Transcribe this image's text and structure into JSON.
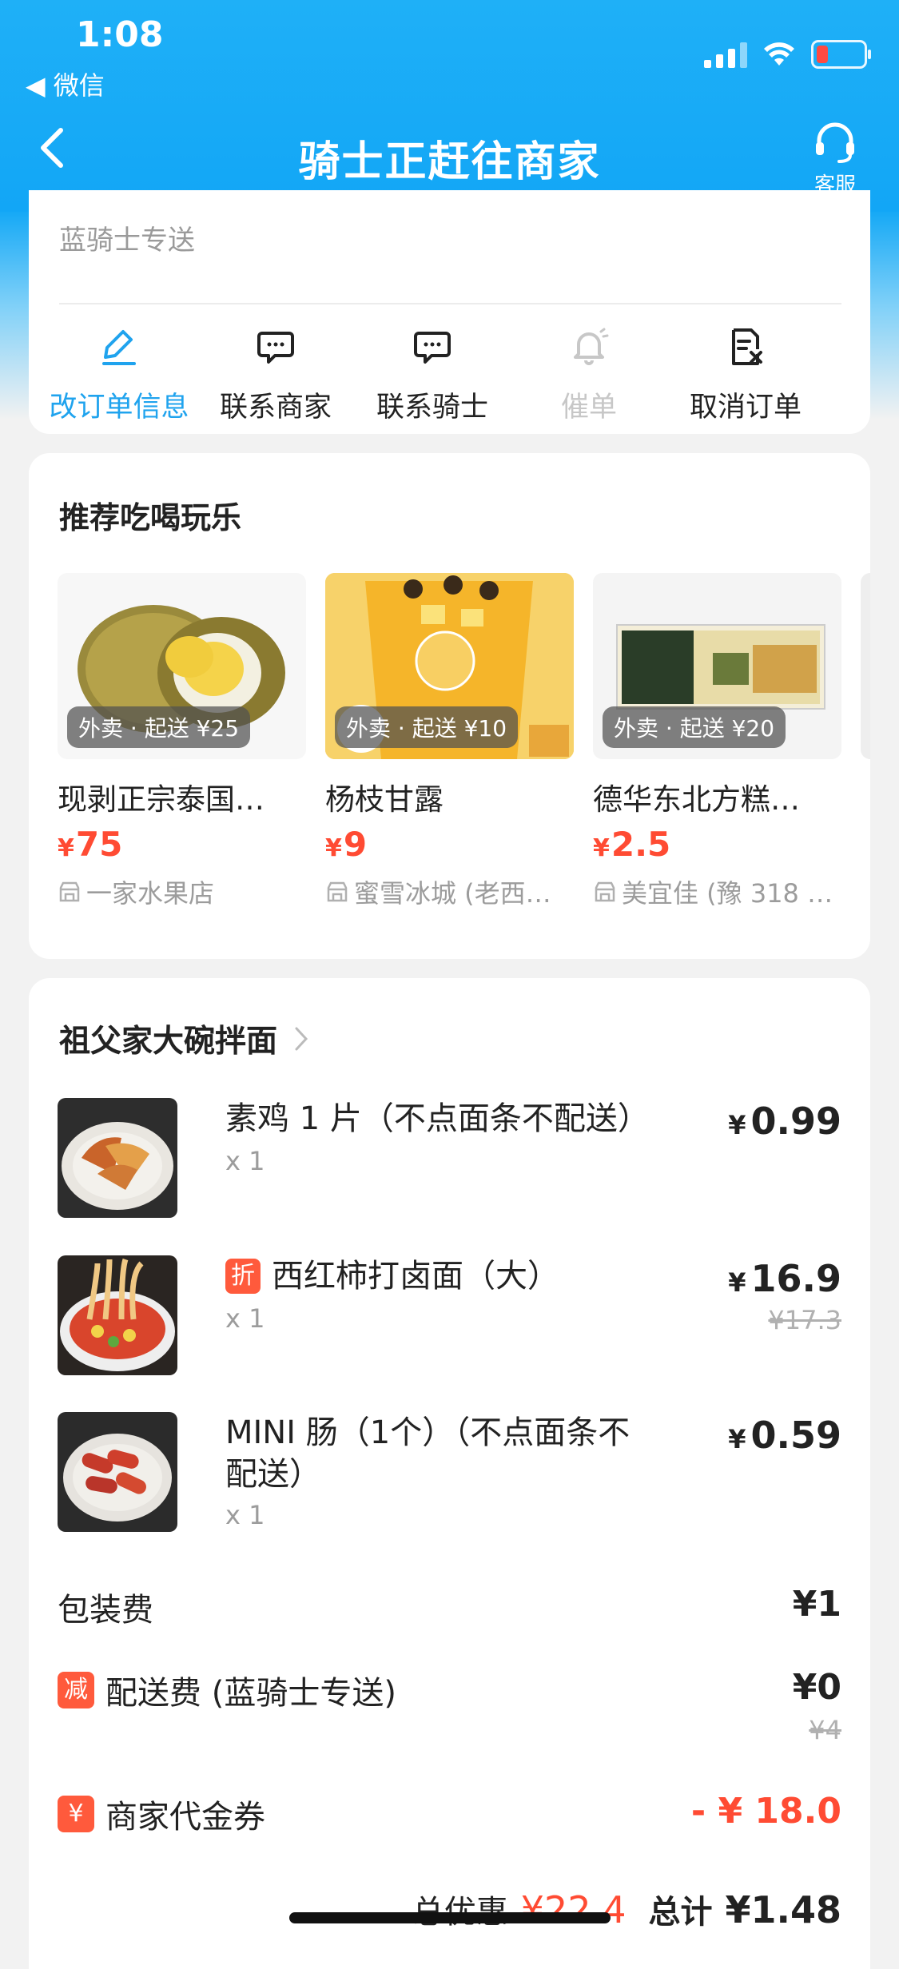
{
  "status_bar": {
    "time": "1:08",
    "back_app": "◀ 微信"
  },
  "nav": {
    "title": "骑士正赶往商家",
    "service_label": "客服"
  },
  "rider_card": {
    "label": "蓝骑士专送",
    "actions": [
      {
        "label": "改订单信息",
        "icon": "edit-icon",
        "state": "active"
      },
      {
        "label": "联系商家",
        "icon": "chat-icon",
        "state": "normal"
      },
      {
        "label": "联系骑士",
        "icon": "chat-icon",
        "state": "normal"
      },
      {
        "label": "催单",
        "icon": "bell-icon",
        "state": "disabled"
      },
      {
        "label": "取消订单",
        "icon": "cancel-order-icon",
        "state": "normal"
      }
    ]
  },
  "recommend": {
    "title": "推荐吃喝玩乐",
    "items": [
      {
        "name": "现剥正宗泰国…",
        "price": "75",
        "tag": "外卖 · 起送 ¥25",
        "shop": "一家水果店"
      },
      {
        "name": "杨枝甘露",
        "price": "9",
        "tag": "外卖 · 起送 ¥10",
        "shop": "蜜雪冰城 (老西…"
      },
      {
        "name": "德华东北方糕…",
        "price": "2.5",
        "tag": "外卖 · 起送 ¥20",
        "shop": "美宜佳 (豫 318 …"
      }
    ],
    "currency": "¥"
  },
  "order": {
    "store_name": "祖父家大碗拌面",
    "items": [
      {
        "name": "素鸡 1 片（不点面条不配送）",
        "qty": "x 1",
        "price": "0.99",
        "orig": "",
        "discount_badge": ""
      },
      {
        "name": "西红柿打卤面（大）",
        "qty": "x 1",
        "price": "16.9",
        "orig": "¥17.3",
        "discount_badge": "折"
      },
      {
        "name": "MINI 肠（1个）（不点面条不配送）",
        "qty": "x 1",
        "price": "0.59",
        "orig": "",
        "discount_badge": ""
      }
    ],
    "packing": {
      "label": "包装费",
      "value": "¥1"
    },
    "delivery": {
      "badge": "减",
      "label": "配送费 (蓝骑士专送)",
      "value": "¥0",
      "orig": "¥4"
    },
    "voucher": {
      "badge": "¥",
      "label": "商家代金券",
      "value": "- ¥ 18.0"
    },
    "total": {
      "discount_label": "总优惠",
      "discount_value": "¥22.4",
      "total_label": "总计",
      "total_value": "¥1.48"
    },
    "currency": "¥"
  }
}
